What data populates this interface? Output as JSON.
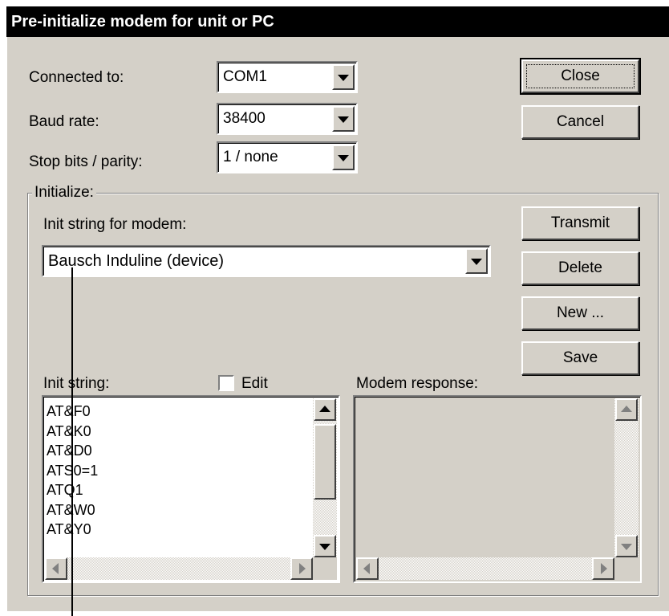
{
  "window": {
    "title": "Pre-initialize modem for unit or PC"
  },
  "fields": {
    "connected_to": {
      "label": "Connected to:",
      "value": "COM1"
    },
    "baud_rate": {
      "label": "Baud rate:",
      "value": "38400"
    },
    "stop_bits": {
      "label": "Stop bits / parity:",
      "value": "1 / none"
    }
  },
  "buttons": {
    "close": "Close",
    "cancel": "Cancel",
    "transmit": "Transmit",
    "delete": "Delete",
    "new": "New ...",
    "save": "Save"
  },
  "initialize": {
    "group_label": "Initialize:",
    "init_string_label": "Init string for modem:",
    "selected_init": "Bausch Induline (device)",
    "init_lines_label": "Init string:",
    "edit_label": "Edit",
    "edit_checked": false,
    "init_lines": [
      "AT&F0",
      "AT&K0",
      "AT&D0",
      "ATS0=1",
      "ATQ1",
      "AT&W0",
      "AT&Y0"
    ],
    "modem_response_label": "Modem response:",
    "modem_response_lines": []
  },
  "icons": [
    "dropdown-arrow-icon",
    "scroll-up-icon",
    "scroll-down-icon",
    "scroll-left-icon",
    "scroll-right-icon",
    "checkbox-icon"
  ],
  "colors": {
    "titlebar": "#000000",
    "face": "#d4d0c8",
    "field": "#ffffff"
  }
}
